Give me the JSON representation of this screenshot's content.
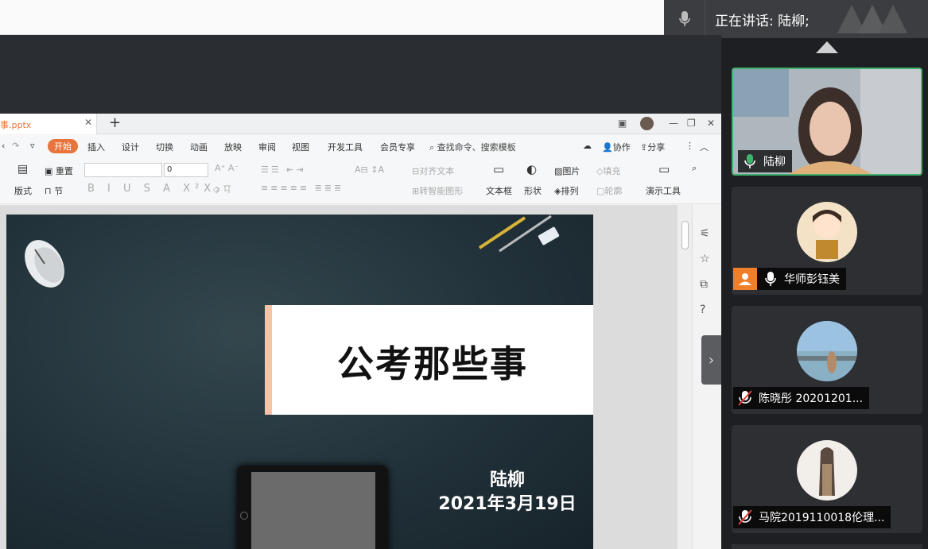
{
  "speaker": {
    "text": "正在讲话: 陆柳;"
  },
  "app": {
    "tab_title": "事.pptx",
    "menu": [
      "开始",
      "插入",
      "设计",
      "切换",
      "动画",
      "放映",
      "审阅",
      "视图",
      "开发工具",
      "会员专享"
    ],
    "search_label": "查找命令、搜索模板",
    "right_actions": [
      "协作",
      "分享"
    ],
    "toolbar": {
      "reset": "重置",
      "layout": "版式",
      "section": "节",
      "font_size": "0",
      "align_text": "对齐文本",
      "smart_art": "转智能图形",
      "textbox": "文本框",
      "shape": "形状",
      "picture": "图片",
      "arrange": "排列",
      "fill": "填充",
      "outline": "轮廓",
      "present_tools": "演示工具"
    }
  },
  "slide": {
    "title": "公考那些事",
    "author": "陆柳",
    "date": "2021年3月19日"
  },
  "participants": [
    {
      "name": "陆柳",
      "mic": "on",
      "active": true
    },
    {
      "name": "华师彭钰美",
      "mic": "on",
      "active": false
    },
    {
      "name": "陈晓彤 20201201...",
      "mic": "muted",
      "active": false
    },
    {
      "name": "马院2019110018伦理...",
      "mic": "muted",
      "active": false
    }
  ],
  "colors": {
    "accent": "#e8743b",
    "active_border": "#3fb26b",
    "mic_on": "#3fb26b"
  }
}
